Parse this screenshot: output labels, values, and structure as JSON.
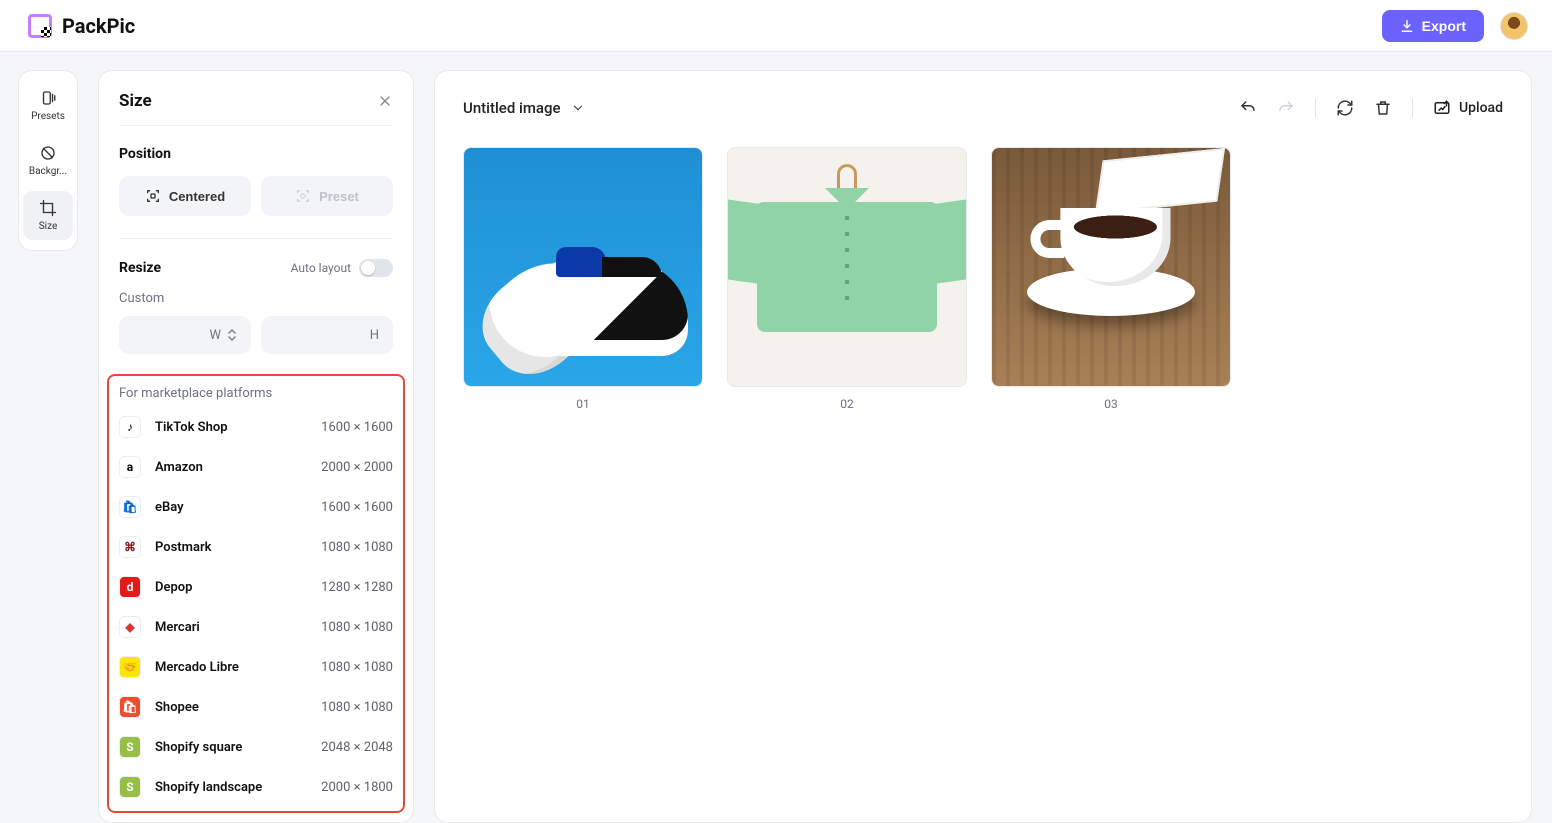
{
  "header": {
    "app_name": "PackPic",
    "export_label": "Export"
  },
  "rail": {
    "items": [
      {
        "label": "Presets"
      },
      {
        "label": "Backgr..."
      },
      {
        "label": "Size"
      }
    ],
    "active_index": 2
  },
  "panel": {
    "title": "Size",
    "position_label": "Position",
    "buttons": {
      "centered": "Centered",
      "preset": "Preset"
    },
    "resize_label": "Resize",
    "auto_layout_label": "Auto layout",
    "custom_label": "Custom",
    "w_label": "W",
    "h_label": "H",
    "marketplace_title": "For marketplace platforms",
    "platforms": [
      {
        "name": "TikTok Shop",
        "size": "1600 × 1600",
        "icon_bg": "#ffffff",
        "icon_fg": "#000000",
        "glyph": "♪"
      },
      {
        "name": "Amazon",
        "size": "2000 × 2000",
        "icon_bg": "#ffffff",
        "icon_fg": "#000000",
        "glyph": "a"
      },
      {
        "name": "eBay",
        "size": "1600 × 1600",
        "icon_bg": "#ffffff",
        "icon_fg": "#0064d2",
        "glyph": "🛍"
      },
      {
        "name": "Postmark",
        "size": "1080 × 1080",
        "icon_bg": "#ffffff",
        "icon_fg": "#8b1a1a",
        "glyph": "⌘"
      },
      {
        "name": "Depop",
        "size": "1280 × 1280",
        "icon_bg": "#e21a1a",
        "icon_fg": "#ffffff",
        "glyph": "d"
      },
      {
        "name": "Mercari",
        "size": "1080 × 1080",
        "icon_bg": "#ffffff",
        "icon_fg": "#d63832",
        "glyph": "◆"
      },
      {
        "name": "Mercado Libre",
        "size": "1080 × 1080",
        "icon_bg": "#ffe600",
        "icon_fg": "#2d6cdf",
        "glyph": "🤝"
      },
      {
        "name": "Shopee",
        "size": "1080 × 1080",
        "icon_bg": "#ee4d2d",
        "icon_fg": "#ffffff",
        "glyph": "🛍"
      },
      {
        "name": "Shopify square",
        "size": "2048 × 2048",
        "icon_bg": "#95bf47",
        "icon_fg": "#ffffff",
        "glyph": "S"
      },
      {
        "name": "Shopify landscape",
        "size": "2000 × 1800",
        "icon_bg": "#95bf47",
        "icon_fg": "#ffffff",
        "glyph": "S"
      }
    ]
  },
  "canvas": {
    "image_title": "Untitled image",
    "upload_label": "Upload",
    "thumbs": [
      {
        "label": "01"
      },
      {
        "label": "02"
      },
      {
        "label": "03"
      }
    ]
  }
}
